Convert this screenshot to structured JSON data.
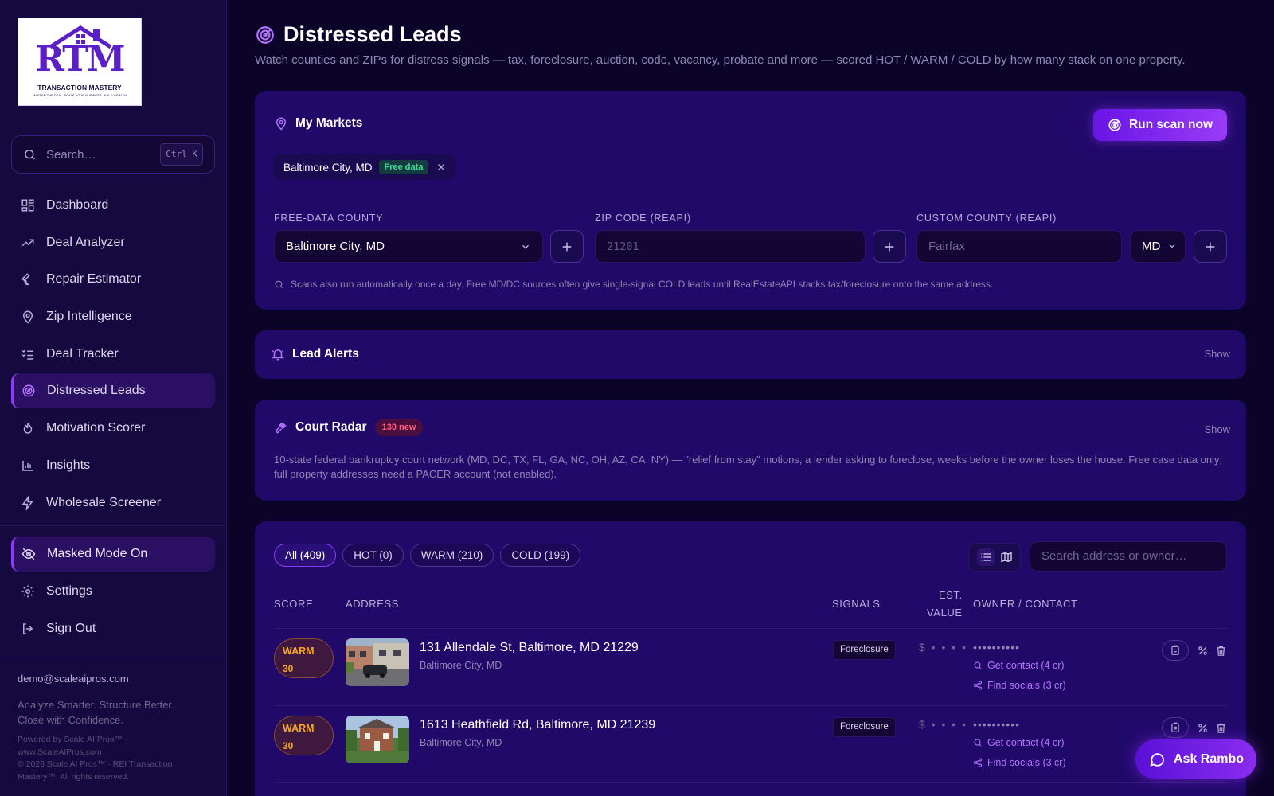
{
  "brand": {
    "logo_letters": "RTM",
    "logo_line1": "TRANSACTION MASTERY",
    "logo_line2": "MASTER THE DEAL. SCALE YOUR BUSINESS. BUILD WEALTH"
  },
  "sidebar": {
    "search_placeholder": "Search…",
    "search_shortcut": "Ctrl K",
    "items": [
      {
        "label": "Dashboard",
        "icon": "dashboard-icon"
      },
      {
        "label": "Deal Analyzer",
        "icon": "trend-icon"
      },
      {
        "label": "Repair Estimator",
        "icon": "wrench-icon"
      },
      {
        "label": "Zip Intelligence",
        "icon": "map-pin-icon"
      },
      {
        "label": "Deal Tracker",
        "icon": "checklist-icon"
      },
      {
        "label": "Distressed Leads",
        "icon": "radar-icon",
        "active": true
      },
      {
        "label": "Motivation Scorer",
        "icon": "flame-icon"
      },
      {
        "label": "Insights",
        "icon": "bar-chart-icon"
      },
      {
        "label": "Wholesale Screener",
        "icon": "bolt-icon"
      }
    ],
    "masked_mode": "Masked Mode On",
    "settings": "Settings",
    "sign_out": "Sign Out",
    "email": "demo@scaleaipros.com",
    "tagline": "Analyze Smarter. Structure Better. Close with Confidence.",
    "powered": "Powered by Scale AI Pros™ · www.ScaleAIPros.com",
    "copyright": "© 2026 Scale AI Pros™ · REI Transaction Mastery™. All rights reserved."
  },
  "page": {
    "title": "Distressed Leads",
    "subtitle": "Watch counties and ZIPs for distress signals — tax, foreclosure, auction, code, vacancy, probate and more — scored HOT / WARM / COLD by how many stack on one property."
  },
  "markets": {
    "title": "My Markets",
    "run_button": "Run scan now",
    "chip_label": "Baltimore City, MD",
    "chip_badge": "Free data",
    "free_county_label": "FREE-DATA COUNTY",
    "free_county_value": "Baltimore City, MD",
    "zip_label": "ZIP CODE (REAPI)",
    "zip_placeholder": "21201",
    "custom_label": "CUSTOM COUNTY (REAPI)",
    "custom_placeholder": "Fairfax",
    "state_value": "MD",
    "hint": "Scans also run automatically once a day. Free MD/DC sources often give single-signal COLD leads until RealEstateAPI stacks tax/foreclosure onto the same address."
  },
  "alerts": {
    "title": "Lead Alerts",
    "toggle": "Show"
  },
  "court": {
    "title": "Court Radar",
    "badge": "130 new",
    "toggle": "Show",
    "description": "10-state federal bankruptcy court network (MD, DC, TX, FL, GA, NC, OH, AZ, CA, NY) — \"relief from stay\" motions, a lender asking to foreclose, weeks before the owner loses the house. Free case data only; full property addresses need a PACER account (not enabled)."
  },
  "leads": {
    "tabs": [
      "All (409)",
      "HOT (0)",
      "WARM (210)",
      "COLD (199)"
    ],
    "search_placeholder": "Search address or owner…",
    "columns": {
      "score": "SCORE",
      "address": "ADDRESS",
      "signals": "SIGNALS",
      "est_value_1": "EST.",
      "est_value_2": "VALUE",
      "owner": "OWNER / CONTACT"
    },
    "rows": [
      {
        "score_label": "WARM",
        "score": "30",
        "address": "131 Allendale St, Baltimore, MD 21229",
        "county": "Baltimore City, MD",
        "signal": "Foreclosure",
        "est_value": "$ • • • •",
        "owner": "••••••••••",
        "get_contact": "Get contact (4 cr)",
        "find_socials": "Find socials (3 cr)"
      },
      {
        "score_label": "WARM",
        "score": "30",
        "address": "1613 Heathfield Rd, Baltimore, MD 21239",
        "county": "Baltimore City, MD",
        "signal": "Foreclosure",
        "est_value": "$ • • • •",
        "owner": "••••••••••",
        "get_contact": "Get contact (4 cr)",
        "find_socials": "Find socials (3 cr)"
      }
    ]
  },
  "assistant": {
    "label": "Ask Rambo"
  },
  "colors": {
    "accent": "#8b3cf7",
    "background": "#0c0428",
    "card": "#21096a",
    "warm": "#f5a623",
    "free_badge": "#3ddc97",
    "new_badge": "#ff5e7e"
  }
}
